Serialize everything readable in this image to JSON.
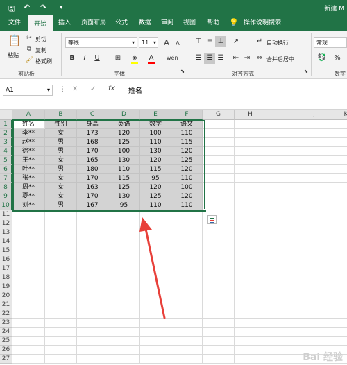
{
  "titlebar": {
    "save": "🖫",
    "undo": "↶",
    "redo": "↷",
    "customize": "▾",
    "title": "新建 M"
  },
  "tabs": [
    "文件",
    "开始",
    "插入",
    "页面布局",
    "公式",
    "数据",
    "审阅",
    "视图",
    "帮助",
    "操作说明搜索"
  ],
  "ribbon": {
    "paste": "粘贴",
    "cut": "剪切",
    "copy": "复制",
    "format_painter": "格式刷",
    "clipboard_label": "剪贴板",
    "font_name": "等线",
    "font_size": "11",
    "bold": "B",
    "italic": "I",
    "underline": "U",
    "font_color_letter": "A",
    "wen": "wén",
    "font_label": "字体",
    "wrap_text": "自动换行",
    "merge_center": "合并后居中",
    "alignment_label": "对齐方式",
    "number_format": "常规",
    "percent": "%",
    "number_label": "数字"
  },
  "formula_bar": {
    "name_box": "A1",
    "cancel": "✕",
    "enter": "✓",
    "fx": "fx",
    "content": "姓名"
  },
  "columns": [
    "A",
    "B",
    "C",
    "D",
    "E",
    "F",
    "G",
    "H",
    "I",
    "J",
    "K"
  ],
  "rows": [
    "1",
    "2",
    "3",
    "4",
    "5",
    "6",
    "7",
    "8",
    "9",
    "10",
    "11",
    "12",
    "13",
    "14",
    "15",
    "16",
    "17",
    "18",
    "19",
    "20",
    "21",
    "22",
    "23",
    "24",
    "25",
    "26",
    "27"
  ],
  "table": [
    [
      "姓名",
      "性别",
      "身高",
      "英语",
      "数学",
      "语文"
    ],
    [
      "李**",
      "女",
      "173",
      "120",
      "100",
      "110"
    ],
    [
      "赵**",
      "男",
      "168",
      "125",
      "110",
      "115"
    ],
    [
      "徐**",
      "男",
      "170",
      "100",
      "130",
      "120"
    ],
    [
      "王**",
      "女",
      "165",
      "130",
      "120",
      "125"
    ],
    [
      "叶**",
      "男",
      "180",
      "110",
      "115",
      "120"
    ],
    [
      "张**",
      "女",
      "170",
      "115",
      "95",
      "110"
    ],
    [
      "周**",
      "女",
      "163",
      "125",
      "120",
      "100"
    ],
    [
      "夏**",
      "女",
      "170",
      "130",
      "125",
      "120"
    ],
    [
      "刘**",
      "男",
      "167",
      "95",
      "110",
      "110"
    ]
  ],
  "colors": {
    "accent": "#217346",
    "arrow": "#e8403a",
    "selection": "#d3d3d3"
  },
  "watermark": "Bai 经验"
}
